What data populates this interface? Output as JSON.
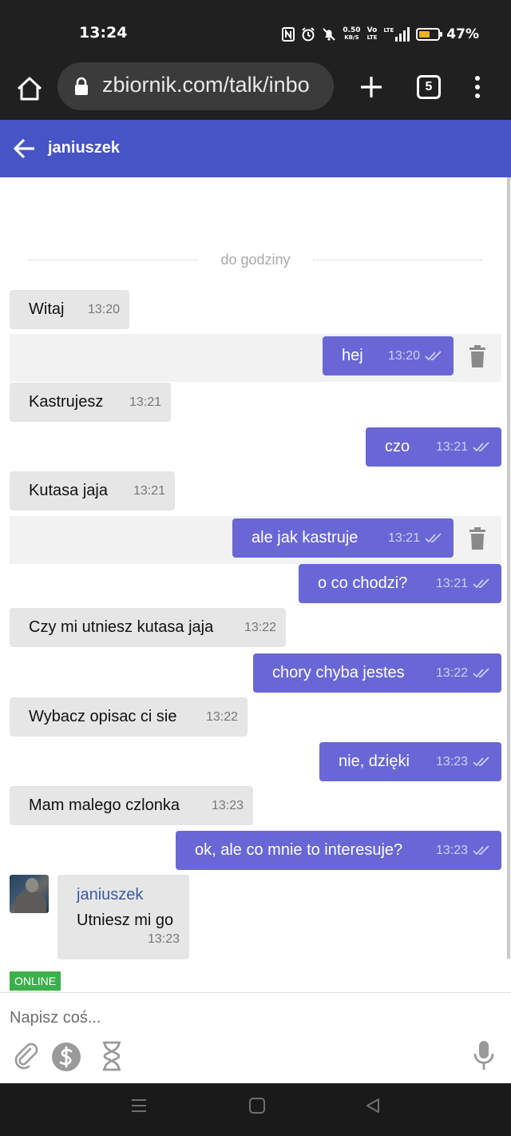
{
  "status": {
    "time": "13:24",
    "net_speed_top": "0.50",
    "net_speed_bottom": "KB/S",
    "volte_top": "Vo",
    "volte_bottom": "LTE",
    "lte_label": "LTE",
    "battery": "47%",
    "battery_level": 0.47,
    "battery_color": "#e8b21d"
  },
  "browser": {
    "url": "zbiornik.com/talk/inbo",
    "tab_count": "5"
  },
  "header": {
    "title": "janiuszek",
    "color": "#4754c5"
  },
  "chat": {
    "divider_label": "do godziny",
    "messages": [
      {
        "dir": "in",
        "text": "Witaj",
        "time": "13:20"
      },
      {
        "dir": "out",
        "text": "hej",
        "time": "13:20"
      },
      {
        "dir": "in",
        "text": "Kastrujesz",
        "time": "13:21"
      },
      {
        "dir": "out",
        "text": "czo",
        "time": "13:21"
      },
      {
        "dir": "in",
        "text": "Kutasa jaja",
        "time": "13:21"
      },
      {
        "dir": "out",
        "text": "ale jak kastruje",
        "time": "13:21"
      },
      {
        "dir": "out",
        "text": "o co chodzi?",
        "time": "13:21"
      },
      {
        "dir": "in",
        "text": "Czy mi utniesz kutasa jaja",
        "time": "13:22"
      },
      {
        "dir": "out",
        "text": "chory chyba jestes",
        "time": "13:22"
      },
      {
        "dir": "in",
        "text": "Wybacz opisac ci sie",
        "time": "13:22"
      },
      {
        "dir": "out",
        "text": "nie, dzięki",
        "time": "13:23"
      },
      {
        "dir": "in",
        "text": "Mam malego czlonka",
        "time": "13:23"
      },
      {
        "dir": "out",
        "text": "ok, ale co mnie to interesuje?",
        "time": "13:23"
      }
    ],
    "last": {
      "author": "janiuszek",
      "text": "Utniesz mi go",
      "time": "13:23"
    },
    "online_badge": "ONLINE",
    "outgoing_color": "#6967d6",
    "incoming_color": "#e6e6e6"
  },
  "composer": {
    "placeholder": "Napisz coś..."
  },
  "icons": {
    "home": "home-icon",
    "lock": "lock-icon",
    "plus": "plus-icon",
    "menu": "more-vert-icon",
    "back": "arrow-back-icon",
    "read": "double-check-icon",
    "trash": "trash-icon",
    "attach": "paperclip-icon",
    "dollar": "dollar-icon",
    "hourglass": "hourglass-icon",
    "mic": "microphone-icon"
  }
}
